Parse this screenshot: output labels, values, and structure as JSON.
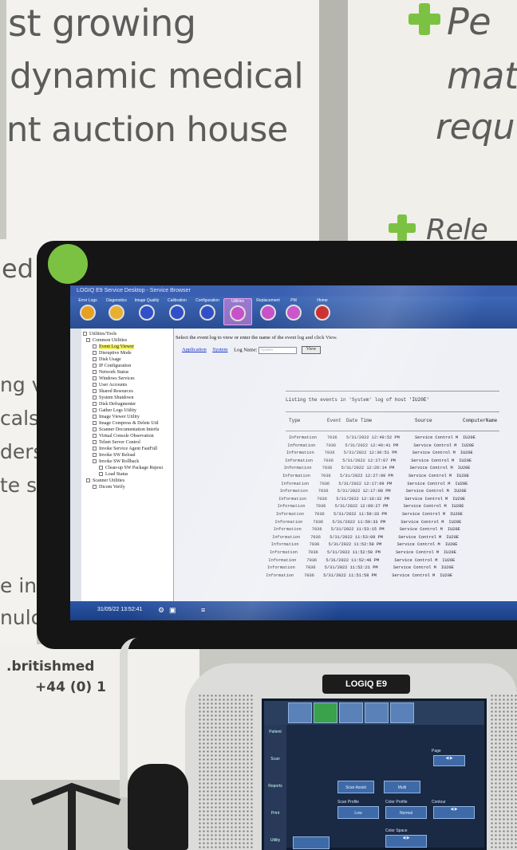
{
  "banner": {
    "left_lines": [
      "st growing",
      "dynamic medical",
      "nt auction house"
    ],
    "right_lines": [
      "Pe",
      "mat",
      "requ"
    ],
    "release": "Rele",
    "side_fragments": [
      "ed",
      "ng v",
      "cals",
      "ders",
      "te se",
      "e in-h",
      "nulcas"
    ],
    "contact_web": ".britishmed",
    "contact_phone": "+44 (0) 1"
  },
  "device": {
    "brand": "LOGIQ E9",
    "colors": {
      "accent_green": "#7cc242",
      "screen_blue": "#2a4d93"
    }
  },
  "app": {
    "title": "LOGIQ E9 Service Desktop - Service Browser",
    "toolbar": [
      {
        "label": "Error Logs",
        "color": "#e8a020"
      },
      {
        "label": "Diagnostics",
        "color": "#e8b030"
      },
      {
        "label": "Image Quality",
        "color": "#3050c8"
      },
      {
        "label": "Calibration",
        "color": "#3050c8"
      },
      {
        "label": "Configuration",
        "color": "#3050c8"
      },
      {
        "label": "Utilities",
        "color": "#c850c8"
      },
      {
        "label": "Replacement",
        "color": "#c850c8"
      },
      {
        "label": "PM",
        "color": "#c850c8"
      },
      {
        "label": "Home",
        "color": "#c82020"
      }
    ],
    "tree": [
      "Utilities/Tools",
      "Common Utilities",
      "Event Log Viewer",
      "Disruptive Mode",
      "Disk Usage",
      "IP Configuration",
      "Network Status",
      "Windows Services",
      "User Accounts",
      "Shared Resources",
      "System Shutdown",
      "Disk Defragmenter",
      "Gather Logs Utility",
      "Image Viewer Utility",
      "Image Compress & Delete Util",
      "Scanner Documentation Interfa",
      "Virtual Console Observation",
      "Telnet Server Control",
      "Invoke Service Agent FastFull",
      "Invoke SW Reload",
      "Invoke SW Rollback",
      "Clean-up SW Package Reposi",
      "Load Status",
      "Scanner Utilities",
      "Dicom Verify"
    ],
    "instructions": "Select the event log to view or enter the name of the event log and click View.",
    "links": [
      "Application",
      "System"
    ],
    "log_name_label": "Log Name:",
    "log_name_value": "System",
    "view_button": "View",
    "listing": "Listing the events in 'System' log of host 'IU20E'",
    "columns": [
      "Type",
      "Event",
      "Date Time",
      "Source",
      "ComputerName"
    ],
    "rows": [
      [
        "Information",
        "7036",
        "5/31/2022 12:49:52 PM",
        "Service Control M",
        "IU20E"
      ],
      [
        "Information",
        "7036",
        "5/31/2022 12:49:41 PM",
        "Service Control M",
        "IU20E"
      ],
      [
        "Information",
        "7036",
        "5/31/2022 12:30:51 PM",
        "Service Control M",
        "IU20E"
      ],
      [
        "Information",
        "7036",
        "5/31/2022 12:27:07 PM",
        "Service Control M",
        "IU20E"
      ],
      [
        "Information",
        "7036",
        "5/31/2022 12:26:14 PM",
        "Service Control M",
        "IU20E"
      ],
      [
        "Information",
        "7036",
        "5/31/2022 12:27:09 PM",
        "Service Control M",
        "IU20E"
      ],
      [
        "Information",
        "7036",
        "5/31/2022 12:17:09 PM",
        "Service Control M",
        "IU20E"
      ],
      [
        "Information",
        "7036",
        "5/31/2022 12:17:08 PM",
        "Service Control M",
        "IU20E"
      ],
      [
        "Information",
        "7036",
        "5/31/2022 12:16:32 PM",
        "Service Control M",
        "IU20E"
      ],
      [
        "Information",
        "7036",
        "5/31/2022 12:09:27 PM",
        "Service Control M",
        "IU20E"
      ],
      [
        "Information",
        "7036",
        "5/31/2022 11:59:33 PM",
        "Service Control M",
        "IU20E"
      ],
      [
        "Information",
        "7036",
        "5/31/2022 11:59:33 PM",
        "Service Control M",
        "IU20E"
      ],
      [
        "Information",
        "7036",
        "5/31/2022 11:53:15 PM",
        "Service Control M",
        "IU20E"
      ],
      [
        "Information",
        "7036",
        "5/31/2022 11:53:09 PM",
        "Service Control M",
        "IU20E"
      ],
      [
        "Information",
        "7036",
        "5/31/2022 11:52:58 PM",
        "Service Control M",
        "IU20E"
      ],
      [
        "Information",
        "7036",
        "5/31/2022 11:52:50 PM",
        "Service Control M",
        "IU20E"
      ],
      [
        "Information",
        "7036",
        "5/31/2022 11:52:46 PM",
        "Service Control M",
        "IU20E"
      ],
      [
        "Information",
        "7036",
        "5/31/2022 11:52:21 PM",
        "Service Control M",
        "IU20E"
      ],
      [
        "Information",
        "7036",
        "5/31/2022 11:51:58 PM",
        "Service Control M",
        "IU20E"
      ]
    ],
    "clock": "31/05/22 13:52:41"
  },
  "touchpanel": {
    "side": [
      "Patient",
      "Scan",
      "Reports",
      "Print",
      "Utility"
    ],
    "labels": [
      "Page",
      "Scan Profile",
      "Color Profile",
      "Contour",
      "Color Space"
    ],
    "buttons": [
      "Scan Assist",
      "Multi",
      "Low",
      "Normal"
    ]
  }
}
